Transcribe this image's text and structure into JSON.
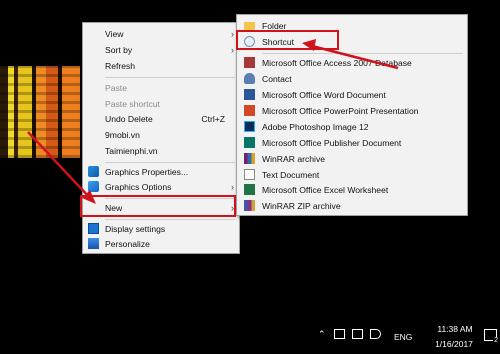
{
  "desktop": {
    "background_color": "#000000"
  },
  "context_menu": {
    "items": [
      {
        "label": "View",
        "submenu": true
      },
      {
        "label": "Sort by",
        "submenu": true
      },
      {
        "label": "Refresh"
      },
      {
        "label": "Paste",
        "disabled": true
      },
      {
        "label": "Paste shortcut",
        "disabled": true
      },
      {
        "label": "Undo Delete",
        "shortcut": "Ctrl+Z"
      },
      {
        "label": "9mobi.vn"
      },
      {
        "label": "Taimienphi.vn"
      },
      {
        "label": "Graphics Properties...",
        "icon": "graphics-icon"
      },
      {
        "label": "Graphics Options",
        "icon": "graphics-options-icon",
        "submenu": true
      },
      {
        "label": "New",
        "submenu": true,
        "highlighted": true
      },
      {
        "label": "Display settings",
        "icon": "display-icon"
      },
      {
        "label": "Personalize",
        "icon": "personalize-icon"
      }
    ]
  },
  "new_submenu": {
    "items": [
      {
        "label": "Folder",
        "icon": "folder-icon"
      },
      {
        "label": "Shortcut",
        "icon": "shortcut-icon",
        "highlighted": true
      },
      {
        "label": "Microsoft Office Access 2007 Database",
        "icon": "access-icon"
      },
      {
        "label": "Contact",
        "icon": "contact-icon"
      },
      {
        "label": "Microsoft Office Word Document",
        "icon": "word-icon"
      },
      {
        "label": "Microsoft Office PowerPoint Presentation",
        "icon": "powerpoint-icon"
      },
      {
        "label": "Adobe Photoshop Image 12",
        "icon": "photoshop-icon"
      },
      {
        "label": "Microsoft Office Publisher Document",
        "icon": "publisher-icon"
      },
      {
        "label": "WinRAR archive",
        "icon": "winrar-icon"
      },
      {
        "label": "Text Document",
        "icon": "text-document-icon"
      },
      {
        "label": "Microsoft Office Excel Worksheet",
        "icon": "excel-icon"
      },
      {
        "label": "WinRAR ZIP archive",
        "icon": "winrar-zip-icon"
      }
    ]
  },
  "annotations": {
    "highlight_color": "#d0121b"
  },
  "taskbar": {
    "language": "ENG",
    "time": "11:38 AM",
    "date": "1/16/2017",
    "notifications_count": "2"
  }
}
